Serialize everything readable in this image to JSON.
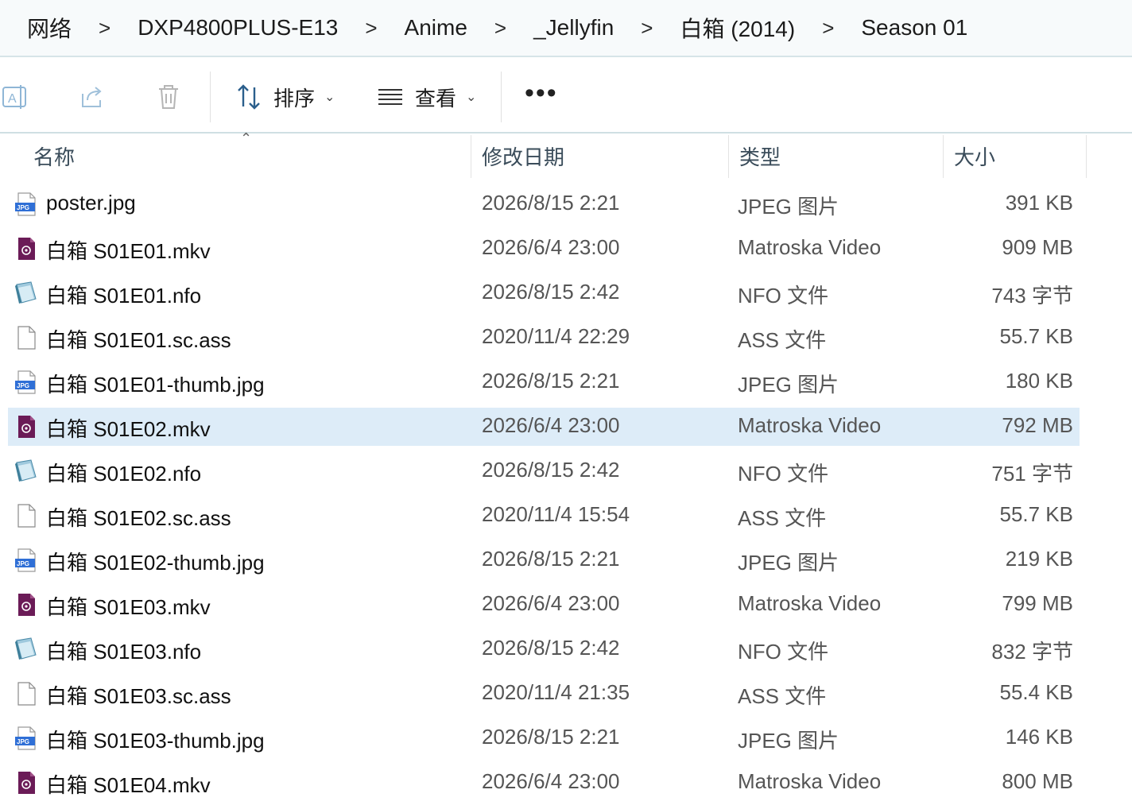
{
  "breadcrumb": [
    "网络",
    "DXP4800PLUS-E13",
    "Anime",
    "_Jellyfin",
    "白箱 (2014)",
    "Season 01"
  ],
  "toolbar": {
    "sort_label": "排序",
    "view_label": "查看",
    "more_label": "•••"
  },
  "columns": {
    "name": "名称",
    "date": "修改日期",
    "type": "类型",
    "size": "大小"
  },
  "files": [
    {
      "name": "poster.jpg",
      "date": "2026/8/15 2:21",
      "type": "JPEG 图片",
      "size": "391 KB",
      "icon": "jpg-file-icon"
    },
    {
      "name": "白箱 S01E01.mkv",
      "date": "2026/6/4 23:00",
      "type": "Matroska Video",
      "size": "909 MB",
      "icon": "video-file-icon"
    },
    {
      "name": "白箱 S01E01.nfo",
      "date": "2026/8/15 2:42",
      "type": "NFO 文件",
      "size": "743 字节",
      "icon": "nfo-file-icon"
    },
    {
      "name": "白箱 S01E01.sc.ass",
      "date": "2020/11/4 22:29",
      "type": "ASS 文件",
      "size": "55.7 KB",
      "icon": "blank-file-icon"
    },
    {
      "name": "白箱 S01E01-thumb.jpg",
      "date": "2026/8/15 2:21",
      "type": "JPEG 图片",
      "size": "180 KB",
      "icon": "jpg-file-icon"
    },
    {
      "name": "白箱 S01E02.mkv",
      "date": "2026/6/4 23:00",
      "type": "Matroska Video",
      "size": "792 MB",
      "icon": "video-file-icon",
      "selected": true
    },
    {
      "name": "白箱 S01E02.nfo",
      "date": "2026/8/15 2:42",
      "type": "NFO 文件",
      "size": "751 字节",
      "icon": "nfo-file-icon"
    },
    {
      "name": "白箱 S01E02.sc.ass",
      "date": "2020/11/4 15:54",
      "type": "ASS 文件",
      "size": "55.7 KB",
      "icon": "blank-file-icon"
    },
    {
      "name": "白箱 S01E02-thumb.jpg",
      "date": "2026/8/15 2:21",
      "type": "JPEG 图片",
      "size": "219 KB",
      "icon": "jpg-file-icon"
    },
    {
      "name": "白箱 S01E03.mkv",
      "date": "2026/6/4 23:00",
      "type": "Matroska Video",
      "size": "799 MB",
      "icon": "video-file-icon"
    },
    {
      "name": "白箱 S01E03.nfo",
      "date": "2026/8/15 2:42",
      "type": "NFO 文件",
      "size": "832 字节",
      "icon": "nfo-file-icon"
    },
    {
      "name": "白箱 S01E03.sc.ass",
      "date": "2020/11/4 21:35",
      "type": "ASS 文件",
      "size": "55.4 KB",
      "icon": "blank-file-icon"
    },
    {
      "name": "白箱 S01E03-thumb.jpg",
      "date": "2026/8/15 2:21",
      "type": "JPEG 图片",
      "size": "146 KB",
      "icon": "jpg-file-icon"
    },
    {
      "name": "白箱 S01E04.mkv",
      "date": "2026/6/4 23:00",
      "type": "Matroska Video",
      "size": "800 MB",
      "icon": "video-file-icon"
    }
  ],
  "colors": {
    "selected_row": "#ddecf8",
    "video_icon": "#6b1b57",
    "jpg_badge": "#2f6fd6"
  }
}
